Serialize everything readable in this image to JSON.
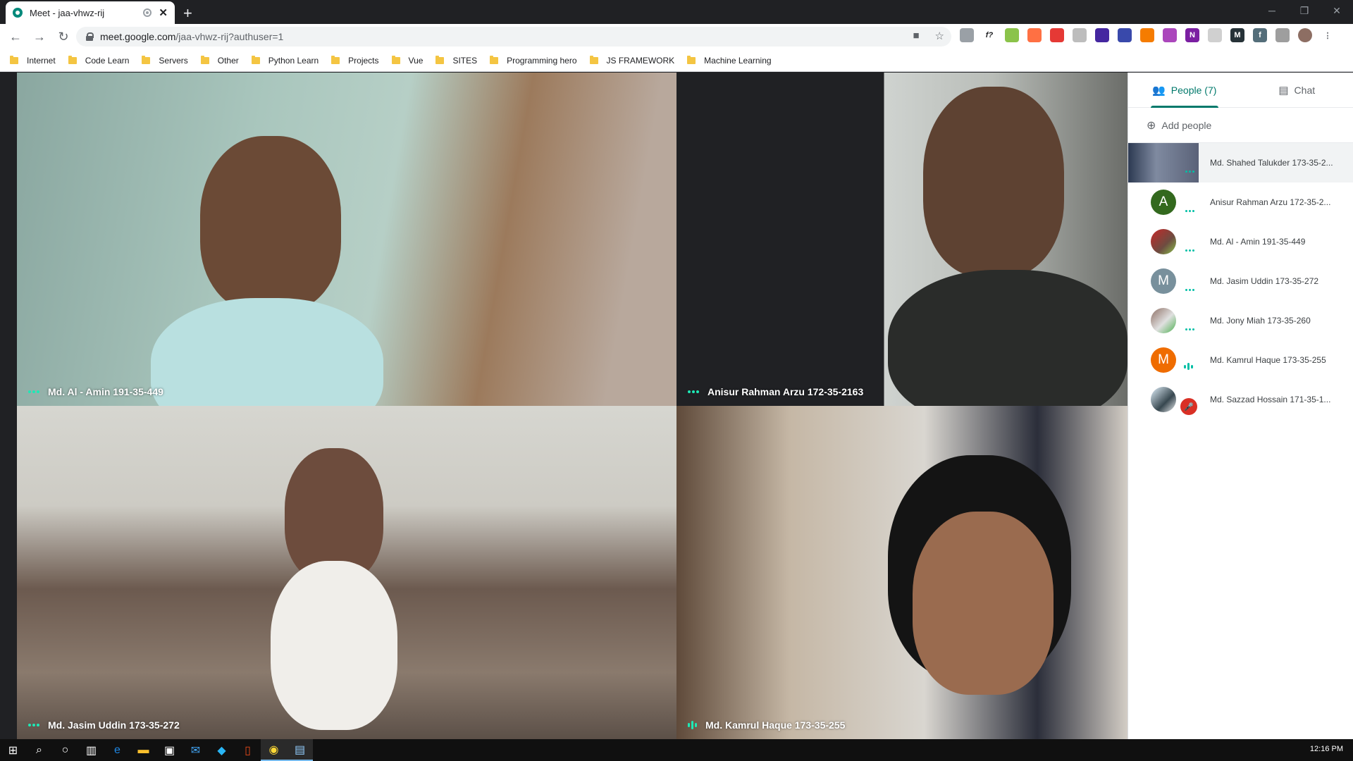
{
  "browser": {
    "tab_title": "Meet - jaa-vhwz-rij",
    "url_host": "meet.google.com",
    "url_path": "/jaa-vhwz-rij?authuser=1",
    "bookmarks": [
      "Internet",
      "Code Learn",
      "Servers",
      "Other",
      "Python Learn",
      "Projects",
      "Vue",
      "SITES",
      "Programming hero",
      "JS FRAMEWORK",
      "Machine Learning"
    ]
  },
  "stage": {
    "tiles": [
      {
        "name": "Md. Al - Amin 191-35-449",
        "indicator": "dots"
      },
      {
        "name": "Anisur Rahman Arzu 172-35-2163",
        "indicator": "dots"
      },
      {
        "name": "Md. Jasim Uddin 173-35-272",
        "indicator": "dots"
      },
      {
        "name": "Md. Kamrul Haque 173-35-255",
        "indicator": "bars"
      }
    ]
  },
  "panel": {
    "people_tab": "People (7)",
    "chat_tab": "Chat",
    "add_people": "Add people",
    "participants": [
      {
        "name": "Md. Shahed Talukder 173-35-2...",
        "avatar": "video-thumb",
        "status": "dots"
      },
      {
        "name": "Anisur Rahman Arzu 172-35-2...",
        "avatar_letter": "A",
        "avatar_color": "#33691e",
        "status": "dots"
      },
      {
        "name": "Md. Al - Amin 191-35-449",
        "avatar": "photo",
        "status": "dots"
      },
      {
        "name": "Md. Jasim Uddin 173-35-272",
        "avatar_letter": "M",
        "avatar_color": "#78909c",
        "status": "dots"
      },
      {
        "name": "Md. Jony Miah 173-35-260",
        "avatar": "photo",
        "status": "dots"
      },
      {
        "name": "Md. Kamrul Haque 173-35-255",
        "avatar_letter": "M",
        "avatar_color": "#ef6c00",
        "status": "speaking"
      },
      {
        "name": "Md. Sazzad Hossain 171-35-1...",
        "avatar": "photo",
        "status": "muted"
      }
    ]
  },
  "taskbar": {
    "clock": "12:16 PM"
  }
}
